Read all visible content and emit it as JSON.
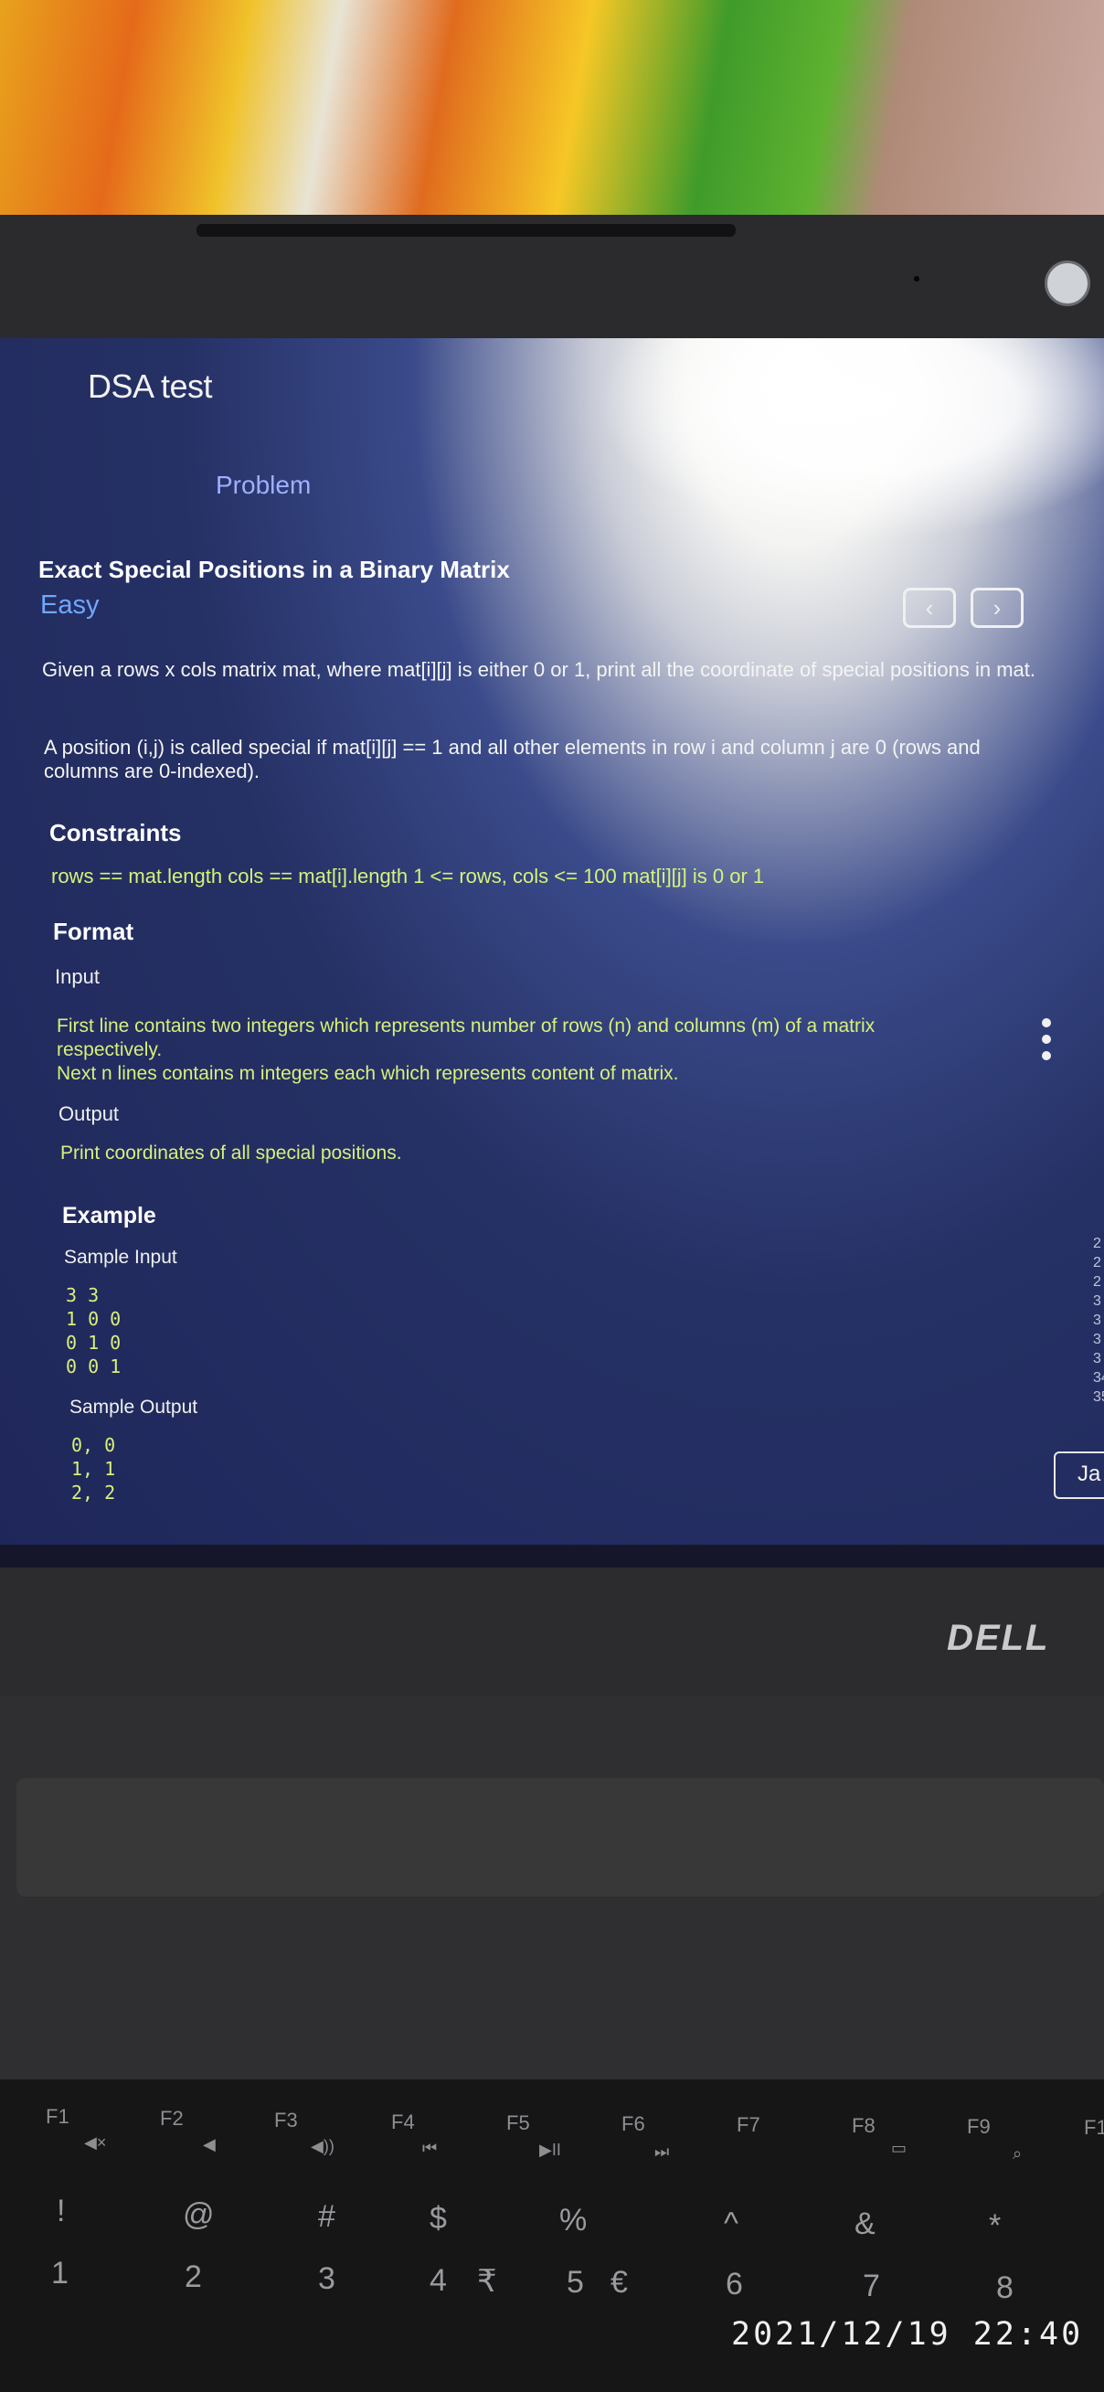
{
  "app": {
    "title": "DSA test"
  },
  "tabs": {
    "problem": "Problem"
  },
  "problem": {
    "title": "Exact Special Positions in a Binary Matrix",
    "difficulty": "Easy",
    "nav_prev": "‹",
    "nav_next": "›",
    "description_1": "Given a rows x cols matrix mat, where mat[i][j] is either 0 or 1, print all the coordinate of special positions in mat.",
    "description_2": "A position (i,j) is called special if mat[i][j] == 1 and all other elements in row i and column j are 0 (rows and columns are 0-indexed)."
  },
  "constraints": {
    "heading": "Constraints",
    "text": "rows == mat.length cols == mat[i].length 1 <= rows, cols <= 100 mat[i][j] is 0 or 1"
  },
  "format": {
    "heading": "Format",
    "input_label": "Input",
    "input_line_1": "First line contains two integers which represents number of rows (n) and columns (m) of a matrix respectively.",
    "input_line_2": "Next n lines contains m integers each which represents content of matrix.",
    "output_label": "Output",
    "output_text": "Print coordinates of all special positions."
  },
  "example": {
    "heading": "Example",
    "sample_input_label": "Sample Input",
    "sample_input": [
      "3 3",
      "1 0 0",
      "0 1 0",
      "0 0 1"
    ],
    "sample_output_label": "Sample Output",
    "sample_output": [
      "0, 0",
      "1, 1",
      "2, 2"
    ]
  },
  "side": {
    "line_numbers": [
      "2",
      "2",
      "2",
      "3",
      "3",
      "3",
      "3",
      "34",
      "35"
    ],
    "lang_button": "Ja"
  },
  "laptop": {
    "brand": "DELL"
  },
  "keyboard": {
    "fkeys": [
      "F1",
      "F2",
      "F3",
      "F4",
      "F5",
      "F6",
      "F7",
      "F8",
      "F9",
      "F1"
    ],
    "symbols": [
      "!",
      "@",
      "#",
      "$",
      "%",
      "^",
      "&",
      "*"
    ],
    "numbers": [
      "1",
      "2",
      "3",
      "4",
      "5",
      "6",
      "7",
      "8"
    ],
    "extras": [
      "₹",
      "€"
    ]
  },
  "photo": {
    "timestamp": "2021/12/19 22:40"
  }
}
